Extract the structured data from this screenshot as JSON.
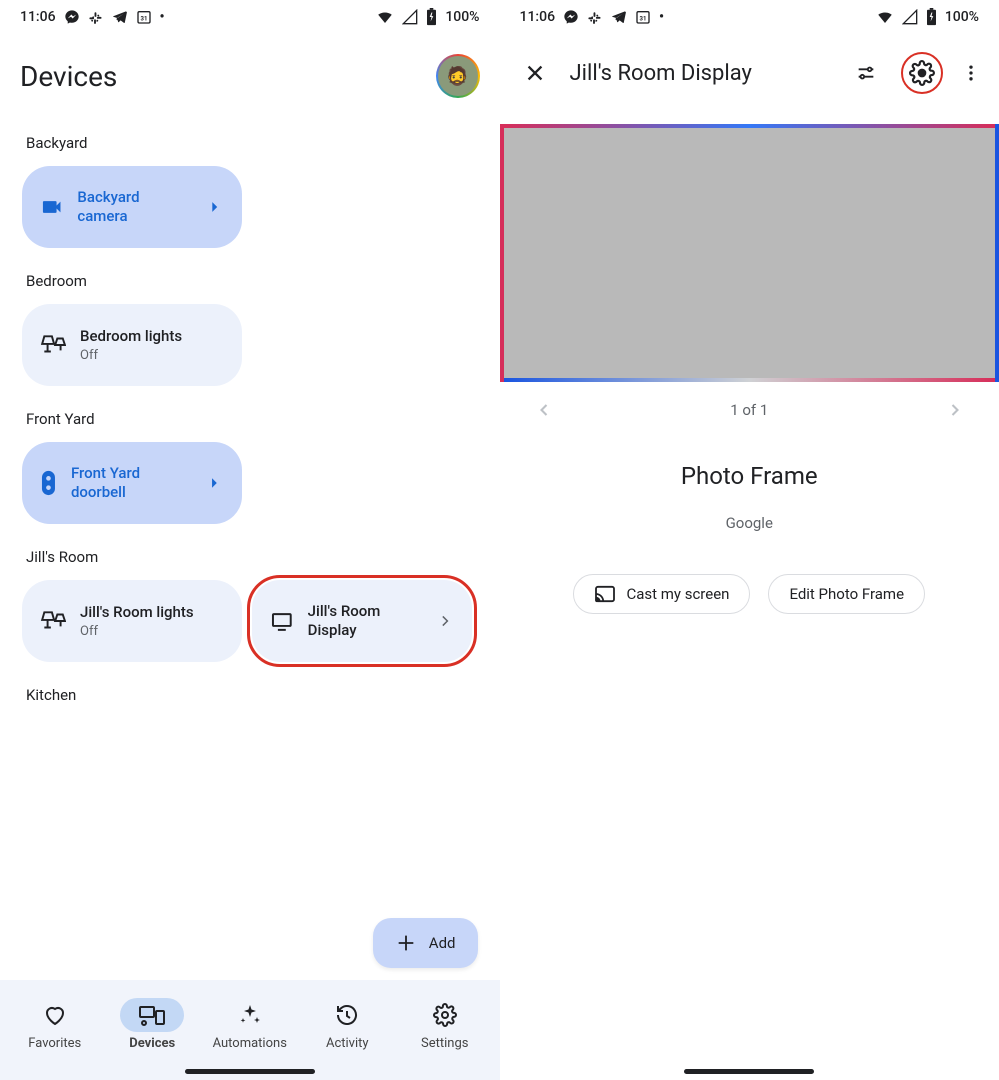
{
  "status": {
    "time": "11:06",
    "battery": "100%"
  },
  "left_screen": {
    "title": "Devices",
    "rooms": [
      {
        "name": "Backyard",
        "cards": [
          {
            "title": "Backyard camera",
            "sub": "",
            "icon": "camera",
            "style": "blue",
            "chevron": true
          }
        ]
      },
      {
        "name": "Bedroom",
        "cards": [
          {
            "title": "Bedroom lights",
            "sub": "Off",
            "icon": "lamp",
            "style": "light",
            "chevron": false
          }
        ]
      },
      {
        "name": "Front Yard",
        "cards": [
          {
            "title": "Front Yard doorbell",
            "sub": "",
            "icon": "doorbell",
            "style": "blue",
            "chevron": true
          }
        ]
      },
      {
        "name": "Jill's Room",
        "cards": [
          {
            "title": "Jill's Room lights",
            "sub": "Off",
            "icon": "lamp",
            "style": "light",
            "chevron": false
          },
          {
            "title": "Jill's Room Display",
            "sub": "",
            "icon": "display",
            "style": "light",
            "chevron": true,
            "highlight": true
          }
        ]
      },
      {
        "name": "Kitchen",
        "cards": []
      }
    ],
    "fab": "Add",
    "nav": [
      {
        "label": "Favorites",
        "icon": "heart"
      },
      {
        "label": "Devices",
        "icon": "devices",
        "active": true
      },
      {
        "label": "Automations",
        "icon": "sparkle"
      },
      {
        "label": "Activity",
        "icon": "history"
      },
      {
        "label": "Settings",
        "icon": "gear"
      }
    ]
  },
  "right_screen": {
    "title": "Jill's Room Display",
    "pager": "1 of 1",
    "product_title": "Photo Frame",
    "product_sub": "Google",
    "actions": {
      "cast": "Cast my screen",
      "edit": "Edit Photo Frame"
    },
    "highlight_settings": true
  }
}
